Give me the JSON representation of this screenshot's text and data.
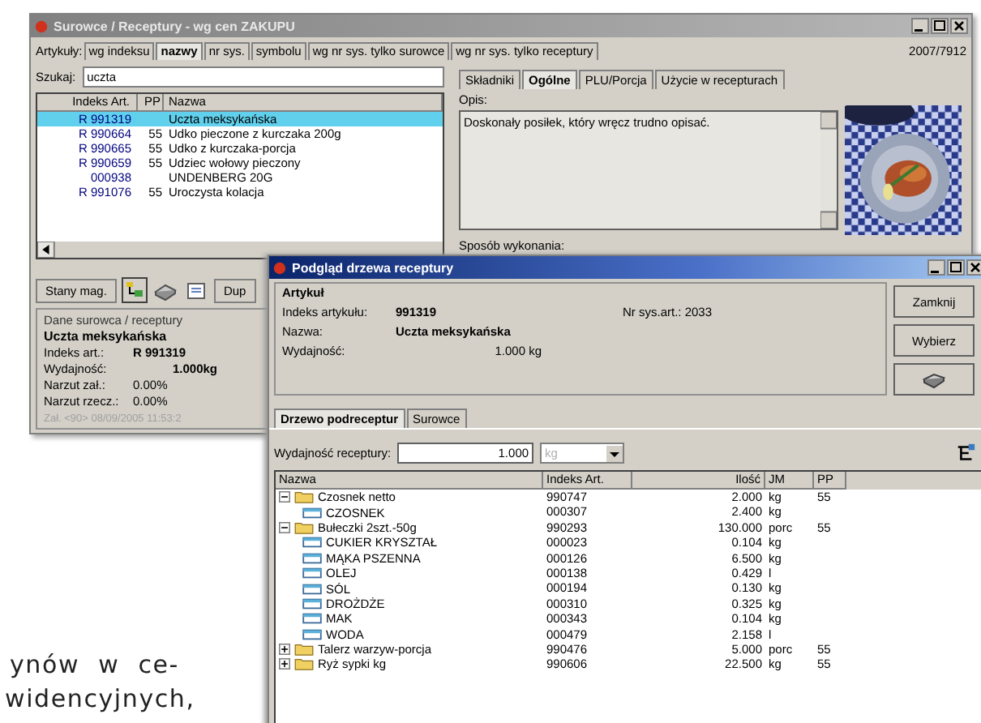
{
  "main_window": {
    "title": "Surowce / Receptury - wg cen ZAKUPU",
    "counter": "2007/7912",
    "sort_label": "Artykuły:",
    "sort_tabs": [
      {
        "label": "wg indeksu",
        "selected": false
      },
      {
        "label": "nazwy",
        "selected": true
      },
      {
        "label": "nr sys.",
        "selected": false
      },
      {
        "label": "symbolu",
        "selected": false
      },
      {
        "label": "wg nr sys. tylko surowce",
        "selected": false
      },
      {
        "label": "wg nr sys. tylko receptury",
        "selected": false
      }
    ],
    "search": {
      "label": "Szukaj:",
      "value": "uczta"
    },
    "list": {
      "columns": [
        "Indeks Art.",
        "PP",
        "Nazwa"
      ],
      "rows": [
        {
          "index": "R 991319",
          "name": "Uczta meksykańska",
          "selected": true
        },
        {
          "index": "R 990664",
          "pp": "55",
          "name": "Udko pieczone z kurczaka 200g",
          "selected": false
        },
        {
          "index": "R 990665",
          "pp": "55",
          "name": "Udko z kurczaka-porcja",
          "selected": false
        },
        {
          "index": "R 990659",
          "pp": "55",
          "name": "Udziec wołowy pieczony",
          "selected": false
        },
        {
          "index": "000938",
          "name": "UNDENBERG 20G",
          "selected": false
        },
        {
          "index": "R 991076",
          "pp": "55",
          "name": "Uroczysta kolacja",
          "selected": false
        }
      ]
    },
    "stock_button": "Stany mag.",
    "dup_button": "Dup",
    "details": {
      "legend": "Dane surowca / receptury",
      "name": "Uczta meksykańska",
      "fields": [
        {
          "label": "Indeks art.:",
          "value": "R 991319",
          "kind": "index"
        },
        {
          "label": "Wydajność:",
          "value": "1.000kg",
          "kind": "yield"
        },
        {
          "label": "Narzut zał.:",
          "value": "0.00%",
          "kind": "plain"
        },
        {
          "label": "Narzut rzecz.:",
          "value": "0.00%",
          "kind": "plain"
        }
      ],
      "footer": "Zał. <90> 08/09/2005 11:53:2"
    },
    "detail_tabs": [
      {
        "label": "Składniki",
        "selected": false
      },
      {
        "label": "Ogólne",
        "selected": true
      },
      {
        "label": "PLU/Porcja",
        "selected": false
      },
      {
        "label": "Użycie w recepturach",
        "selected": false
      }
    ],
    "description": {
      "label": "Opis:",
      "value": "Doskonały posiłek, który wręcz trudno opisać."
    },
    "method_label": "Sposób wykonania:"
  },
  "dialog": {
    "title": "Podgląd drzewa receptury",
    "group": "Artykuł",
    "index_label": "Indeks artykułu:",
    "index": "991319",
    "sys_label": "Nr sys.art.: 2033",
    "name_label": "Nazwa:",
    "name": "Uczta meksykańska",
    "yield_label": "Wydajność:",
    "yield": "1.000 kg",
    "buttons": [
      "Zamknij",
      "Wybierz"
    ],
    "tabs": [
      {
        "label": "Drzewo podreceptur",
        "selected": true
      },
      {
        "label": "Surowce",
        "selected": false
      }
    ],
    "recipe_yield": {
      "label": "Wydajność receptury:",
      "value": "1.000",
      "unit": "kg"
    },
    "tree": {
      "columns": [
        "Nazwa",
        "Indeks Art.",
        "Ilość",
        "JM",
        "PP"
      ],
      "rows": [
        {
          "kind": "folder",
          "expanded": true,
          "name": "Czosnek netto",
          "index": "990747",
          "qty": "2.000",
          "unit": "kg",
          "pp": "55",
          "children": [
            {
              "kind": "item",
              "name": "CZOSNEK",
              "index": "000307",
              "qty": "2.400",
              "unit": "kg"
            }
          ]
        },
        {
          "kind": "folder",
          "expanded": true,
          "name": "Bułeczki 2szt.-50g",
          "index": "990293",
          "qty": "130.000",
          "unit": "porc",
          "pp": "55",
          "children": [
            {
              "kind": "item",
              "name": "CUKIER KRYSZTAŁ",
              "index": "000023",
              "qty": "0.104",
              "unit": "kg"
            },
            {
              "kind": "item",
              "name": "MĄKA PSZENNA",
              "index": "000126",
              "qty": "6.500",
              "unit": "kg"
            },
            {
              "kind": "item",
              "name": "OLEJ",
              "index": "000138",
              "qty": "0.429",
              "unit": "l"
            },
            {
              "kind": "item",
              "name": "SÓL",
              "index": "000194",
              "qty": "0.130",
              "unit": "kg"
            },
            {
              "kind": "item",
              "name": "DROŻDŻE",
              "index": "000310",
              "qty": "0.325",
              "unit": "kg"
            },
            {
              "kind": "item",
              "name": "MAK",
              "index": "000343",
              "qty": "0.104",
              "unit": "kg"
            },
            {
              "kind": "item",
              "name": "WODA",
              "index": "000479",
              "qty": "2.158",
              "unit": "l"
            }
          ]
        },
        {
          "kind": "folder",
          "expanded": false,
          "name": "Talerz warzyw-porcja",
          "index": "990476",
          "qty": "5.000",
          "unit": "porc",
          "pp": "55"
        },
        {
          "kind": "folder",
          "expanded": false,
          "name": "Ryż sypki kg",
          "index": "990606",
          "qty": "22.500",
          "unit": "kg",
          "pp": "55"
        }
      ]
    }
  },
  "article_text": [
    "ynów w ce-",
    "widencyjnych,"
  ]
}
